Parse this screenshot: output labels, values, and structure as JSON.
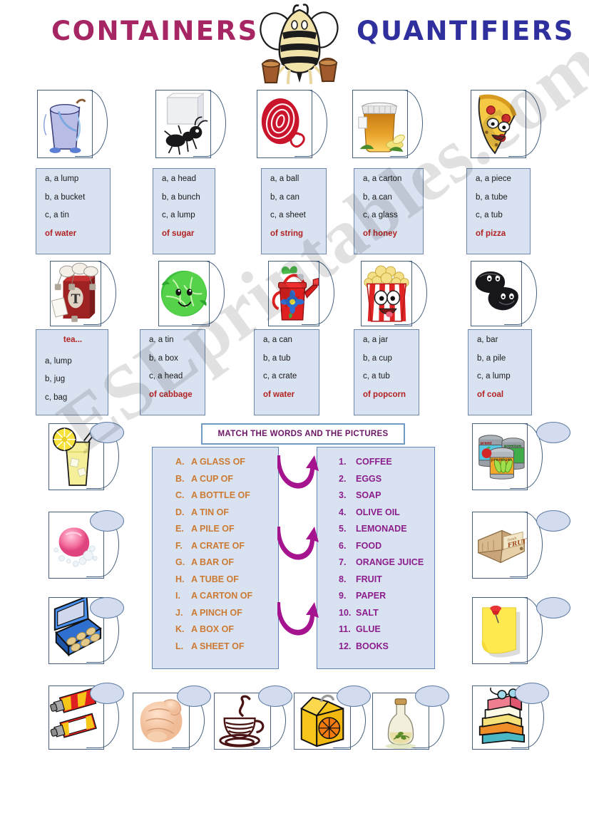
{
  "header": {
    "title_left": "CONTAINERS",
    "title_right": "QUANTIFIERS",
    "mascot": "bee-icon",
    "color_left": "#a52663",
    "color_right": "#2f2f9e"
  },
  "multiple_choice": {
    "row1": [
      {
        "picture": "bucket-of-water-icon",
        "options": [
          "a, a lump",
          "b, a bucket",
          "c, a tin"
        ],
        "answer_suffix": "of water"
      },
      {
        "picture": "ant-carrying-sugar-cube-icon",
        "options": [
          "a, a head",
          "b, a bunch",
          "c, a lump"
        ],
        "answer_suffix": "of sugar"
      },
      {
        "picture": "ball-of-string-icon",
        "options": [
          "a, a ball",
          "b, a can",
          "c, a sheet"
        ],
        "answer_suffix": "of string"
      },
      {
        "picture": "jar-of-honey-icon",
        "options": [
          "a, a carton",
          "b, a can",
          "c, a glass"
        ],
        "answer_suffix": "of honey"
      },
      {
        "picture": "slice-of-pizza-icon",
        "options": [
          "a, a piece",
          "b, a tube",
          "c, a tub"
        ],
        "answer_suffix": "of pizza"
      }
    ],
    "row2": [
      {
        "picture": "tea-bags-box-icon",
        "answer_prefix": "tea...",
        "options": [
          "a, lump",
          "b, jug",
          "c, bag"
        ],
        "answer_suffix": ""
      },
      {
        "picture": "cabbage-icon",
        "options": [
          "a, a tin",
          "b, a box",
          "c, a head"
        ],
        "answer_suffix": "of cabbage"
      },
      {
        "picture": "watering-can-icon",
        "options": [
          "a, a can",
          "b, a tub",
          "c, a crate"
        ],
        "answer_suffix": "of water"
      },
      {
        "picture": "popcorn-bucket-icon",
        "options": [
          "a, a jar",
          "b, a cup",
          "c, a tub"
        ],
        "answer_suffix": "of popcorn"
      },
      {
        "picture": "coal-lumps-icon",
        "options": [
          "a, bar",
          "b, a pile",
          "c, a lump"
        ],
        "answer_suffix": "of coal"
      }
    ]
  },
  "match_exercise": {
    "instruction": "MATCH THE WORDS AND THE PICTURES",
    "instruction_color": "#6b1565",
    "left_color": "#cc7a33",
    "right_color": "#8c1d8c",
    "left_items": [
      {
        "key": "A.",
        "label": "A GLASS OF"
      },
      {
        "key": "B.",
        "label": "A CUP OF"
      },
      {
        "key": "C.",
        "label": "A BOTTLE OF"
      },
      {
        "key": "D.",
        "label": "A TIN OF"
      },
      {
        "key": "E.",
        "label": "A PILE OF"
      },
      {
        "key": "F.",
        "label": "A CRATE OF"
      },
      {
        "key": "G.",
        "label": "A BAR OF"
      },
      {
        "key": "H.",
        "label": "A TUBE OF"
      },
      {
        "key": "I.",
        "label": "A CARTON OF"
      },
      {
        "key": "J.",
        "label": "A PINCH OF"
      },
      {
        "key": "K.",
        "label": "A BOX OF"
      },
      {
        "key": "L.",
        "label": "A SHEET OF"
      }
    ],
    "right_items": [
      {
        "key": "1.",
        "label": "COFFEE"
      },
      {
        "key": "2.",
        "label": "EGGS"
      },
      {
        "key": "3.",
        "label": "SOAP"
      },
      {
        "key": "4.",
        "label": "OLIVE OIL"
      },
      {
        "key": "5.",
        "label": "LEMONADE"
      },
      {
        "key": "6.",
        "label": "FOOD"
      },
      {
        "key": "7.",
        "label": "ORANGE JUICE"
      },
      {
        "key": "8.",
        "label": "FRUIT"
      },
      {
        "key": "9.",
        "label": "PAPER"
      },
      {
        "key": "10.",
        "label": "SALT"
      },
      {
        "key": "11.",
        "label": "GLUE"
      },
      {
        "key": "12.",
        "label": "BOOKS"
      }
    ],
    "arrow_color": "#a5138f",
    "arrow_count": 3
  },
  "match_pictures": {
    "left_column": [
      "glass-of-lemonade-icon",
      "bar-of-soap-icon",
      "carton-of-eggs-icon"
    ],
    "right_column": [
      "tins-of-food-icon",
      "crate-of-fruit-icon",
      "sheet-of-paper-icon"
    ],
    "bottom_row": [
      "tubes-of-glue-icon",
      "pinch-of-salt-hand-icon",
      "cup-of-coffee-icon",
      "carton-of-orange-juice-icon",
      "bottle-of-olive-oil-icon",
      "pile-of-books-icon"
    ]
  },
  "watermark": {
    "text": "ESLprintables.com"
  }
}
